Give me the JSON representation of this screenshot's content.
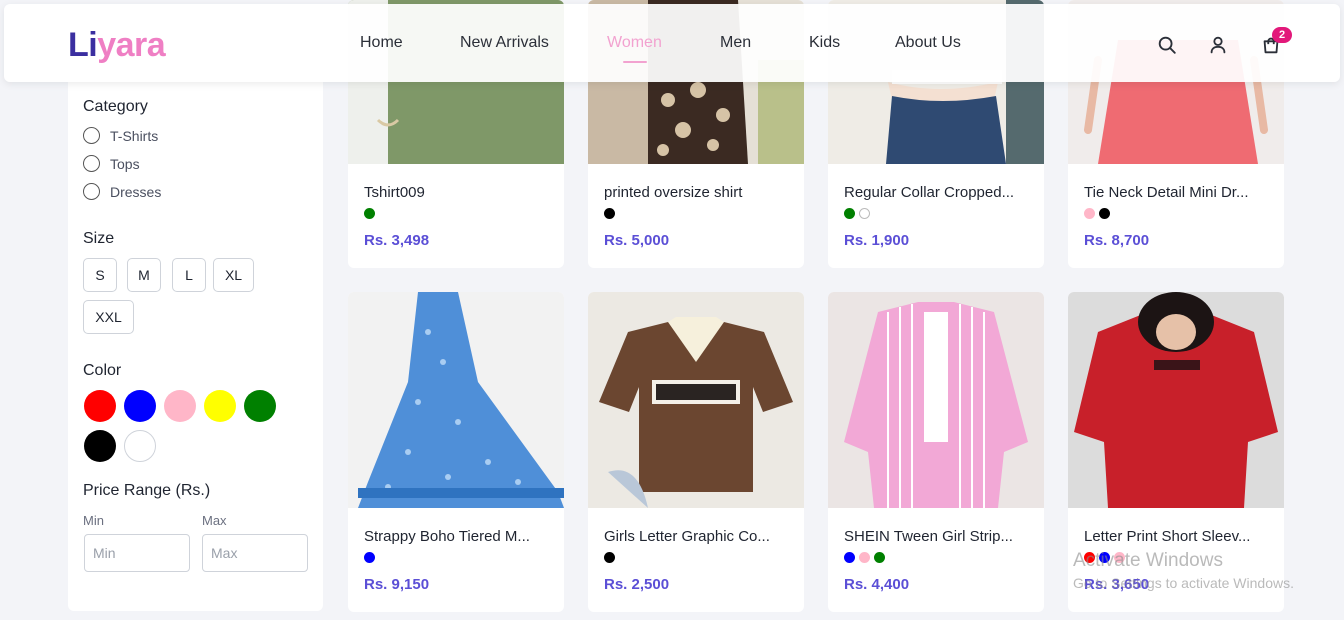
{
  "brand": {
    "part1": "Li",
    "part2": "yara"
  },
  "nav": {
    "items": [
      "Home",
      "New Arrivals",
      "Women",
      "Men",
      "Kids",
      "About Us"
    ],
    "active": "Women"
  },
  "header_icons": {
    "search": "search-icon",
    "account": "user-icon",
    "cart": "shopping-bag-icon",
    "cart_count": "2"
  },
  "filters": {
    "category": {
      "title": "Category",
      "options": [
        "T-Shirts",
        "Tops",
        "Dresses"
      ]
    },
    "size": {
      "title": "Size",
      "options": [
        "S",
        "M",
        "L",
        "XL",
        "XXL"
      ]
    },
    "color": {
      "title": "Color",
      "swatches": [
        "#ff0000",
        "#0000ff",
        "#ffb6c8",
        "#ffff00",
        "#008000",
        "#000000",
        "#ffffff"
      ]
    },
    "price": {
      "title": "Price Range (Rs.)",
      "min_label": "Min",
      "max_label": "Max",
      "min_placeholder": "Min",
      "max_placeholder": "Max"
    }
  },
  "products": [
    {
      "name": "Tshirt009",
      "colors": [
        "#008000"
      ],
      "price": "Rs. 3,498"
    },
    {
      "name": "printed oversize shirt",
      "colors": [
        "#000000"
      ],
      "price": "Rs. 5,000"
    },
    {
      "name": "Regular Collar Cropped...",
      "colors": [
        "#008000",
        "#ffffff"
      ],
      "price": "Rs. 1,900"
    },
    {
      "name": "Tie Neck Detail Mini Dr...",
      "colors": [
        "#ffb6c8",
        "#000000"
      ],
      "price": "Rs. 8,700"
    },
    {
      "name": "Strappy Boho Tiered M...",
      "colors": [
        "#0000ff"
      ],
      "price": "Rs. 9,150"
    },
    {
      "name": "Girls Letter Graphic Co...",
      "colors": [
        "#000000"
      ],
      "price": "Rs. 2,500"
    },
    {
      "name": "SHEIN Tween Girl Strip...",
      "colors": [
        "#0000ff",
        "#ffb6c8",
        "#008000"
      ],
      "price": "Rs. 4,400"
    },
    {
      "name": "Letter Print Short Sleev...",
      "colors": [
        "#ff0000",
        "#0000ff",
        "#ffb6c8"
      ],
      "price": "Rs. 3,650"
    }
  ],
  "product_images": [
    "green-tshirt-image",
    "printed-shirt-image",
    "cropped-top-jeans-image",
    "pink-dress-image",
    "blue-boho-dress-image",
    "new-york-polo-image",
    "pink-striped-shirt-image",
    "red-print-tee-image"
  ],
  "watermark": {
    "line1": "Activate Windows",
    "line2": "Go to Settings to activate Windows."
  }
}
